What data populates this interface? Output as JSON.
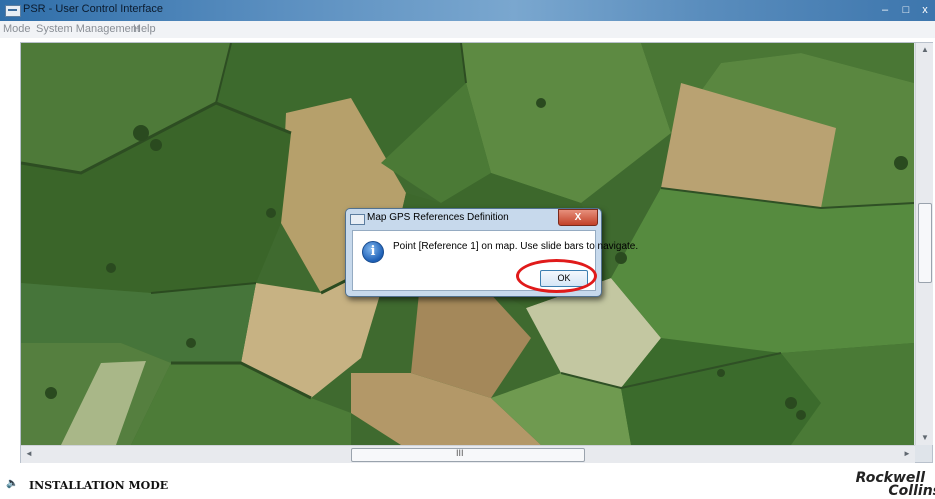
{
  "window": {
    "title": "PSR - User Control Interface",
    "controls": {
      "minimize": "–",
      "maximize": "□",
      "close": "x"
    }
  },
  "menu": {
    "items": [
      {
        "label": "Mode"
      },
      {
        "label": "System Management"
      },
      {
        "label": "Help"
      }
    ]
  },
  "map": {
    "type": "satellite-aerial-image",
    "description_icon": "satellite-map",
    "hscroll": {
      "grip": "III",
      "left_arrow": "◄",
      "right_arrow": "►"
    },
    "vscroll": {
      "up_arrow": "▲",
      "down_arrow": "▼"
    }
  },
  "dialog": {
    "title": "Map GPS References Definition",
    "close_glyph": "X",
    "icon": "info-icon",
    "info_glyph": "i",
    "message": "Point [Reference 1] on map. Use slide bars to navigate.",
    "ok_label": "OK"
  },
  "status": {
    "icon": "speaker-icon",
    "icon_glyph": "🔈",
    "label": "INSTALLATION MODE"
  },
  "logo": {
    "line1": "Rockwell",
    "line2": "Collins"
  },
  "colors": {
    "highlight": "#e01a1a",
    "titlebar": "#5b8fc0",
    "field_dark": "#3a5e2a",
    "field_tan": "#b6a06b"
  }
}
